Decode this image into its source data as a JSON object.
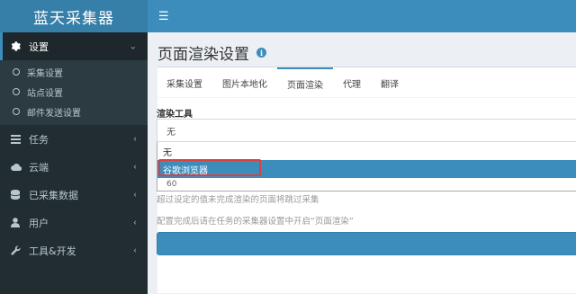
{
  "app": {
    "title": "蓝天采集器"
  },
  "topbar": {
    "menu_icon": "hamburger-icon"
  },
  "sidebar": {
    "settings": {
      "label": "设置",
      "icon": "gear-icon"
    },
    "sub_items": [
      {
        "label": "采集设置"
      },
      {
        "label": "站点设置"
      },
      {
        "label": "邮件发送设置"
      }
    ],
    "items": [
      {
        "label": "任务",
        "icon": "list-icon"
      },
      {
        "label": "云端",
        "icon": "cloud-icon"
      },
      {
        "label": "已采集数据",
        "icon": "database-icon"
      },
      {
        "label": "用户",
        "icon": "user-icon"
      },
      {
        "label": "工具&开发",
        "icon": "wrench-icon"
      }
    ]
  },
  "page": {
    "title": "页面渲染设置",
    "info_icon": "i"
  },
  "tabs": [
    {
      "label": "采集设置"
    },
    {
      "label": "图片本地化"
    },
    {
      "label": "页面渲染",
      "active": true
    },
    {
      "label": "代理"
    },
    {
      "label": "翻译"
    }
  ],
  "form": {
    "render_tool_label": "渲染工具",
    "render_tool_value": "无",
    "options": [
      "无",
      "谷歌浏览器"
    ],
    "partial_value": "60",
    "help_timeout": "超过设定的值未完成渲染的页面将跳过采集",
    "help_enable": "配置完成后请在任务的采集器设置中开启“页面渲染”"
  },
  "colors": {
    "sidebar_bg": "#222d32",
    "brand": "#3c8dbc",
    "highlight_border": "#d9413b"
  }
}
